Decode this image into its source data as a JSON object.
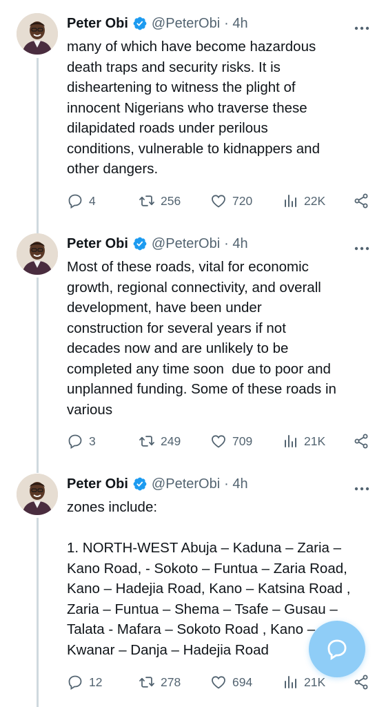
{
  "colors": {
    "accent": "#1d9bf0",
    "muted": "#536471",
    "text": "#0f1419",
    "fab": "#8fcdf7"
  },
  "tweets": [
    {
      "author": "Peter Obi",
      "handle": "@PeterObi",
      "time": "· 4h",
      "text": "many of which have become hazardous\ndeath traps and security risks. It is\ndisheartening to witness the plight of\ninnocent Nigerians who traverse these\ndilapidated roads under perilous\nconditions, vulnerable to kidnappers and\nother dangers.",
      "replies": "4",
      "retweets": "256",
      "likes": "720",
      "views": "22K"
    },
    {
      "author": "Peter Obi",
      "handle": "@PeterObi",
      "time": "· 4h",
      "text": "Most of these roads, vital for economic\ngrowth, regional connectivity, and overall\ndevelopment, have been under\nconstruction for several years if not\ndecades now and are unlikely to be\ncompleted any time soon  due to poor and\nunplanned funding. Some of these roads in\nvarious",
      "replies": "3",
      "retweets": "249",
      "likes": "709",
      "views": "21K"
    },
    {
      "author": "Peter Obi",
      "handle": "@PeterObi",
      "time": "· 4h",
      "text": "zones include:\n\n1. NORTH-WEST Abuja – Kaduna – Zaria –\nKano Road, - Sokoto – Funtua – Zaria Road,\nKano – Hadejia Road, Kano – Katsina Road ,\nZaria – Funtua – Shema – Tsafe – Gusau –\nTalata - Mafara – Sokoto Road , Kano –\nKwanar – Danja – Hadejia Road",
      "replies": "12",
      "retweets": "278",
      "likes": "694",
      "views": "21K"
    }
  ],
  "icons": {
    "reply": "reply-icon",
    "retweet": "retweet-icon",
    "like": "heart-icon",
    "views": "views-icon",
    "share": "share-icon",
    "more": "more-icon",
    "verified": "verified-badge-icon",
    "compose": "compose-icon"
  }
}
